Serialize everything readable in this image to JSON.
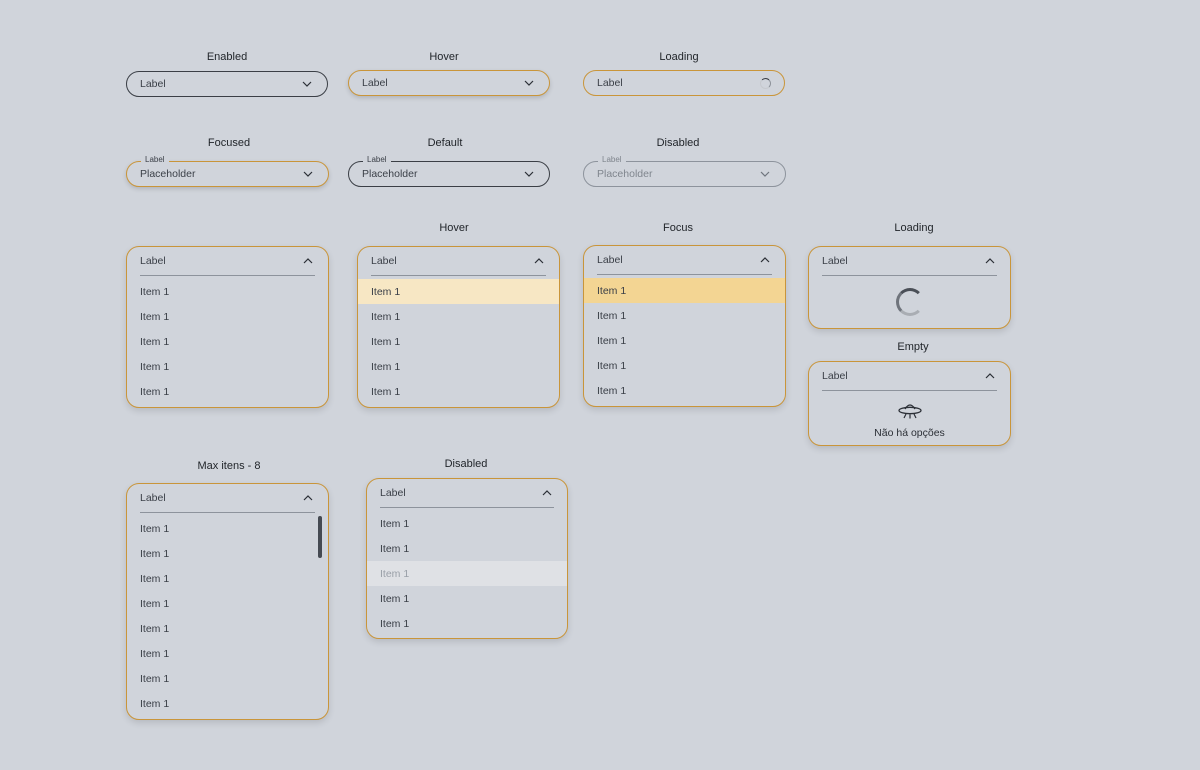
{
  "captions": {
    "enabled": "Enabled",
    "hover": "Hover",
    "loading": "Loading",
    "focused": "Focused",
    "default": "Default",
    "disabled": "Disabled",
    "list_hover": "Hover",
    "list_focus": "Focus",
    "list_loading": "Loading",
    "list_empty": "Empty",
    "max_items": "Max itens - 8",
    "list_disabled": "Disabled"
  },
  "selects": {
    "enabled": {
      "label": "Label"
    },
    "hover": {
      "label": "Label"
    },
    "loading": {
      "label": "Label"
    },
    "focused": {
      "float_label": "Label",
      "placeholder": "Placeholder"
    },
    "default": {
      "float_label": "Label",
      "placeholder": "Placeholder"
    },
    "disabled": {
      "float_label": "Label",
      "placeholder": "Placeholder"
    }
  },
  "lists": {
    "basic": {
      "label": "Label",
      "items": [
        "Item 1",
        "Item 1",
        "Item 1",
        "Item 1",
        "Item 1"
      ]
    },
    "hover": {
      "label": "Label",
      "items": [
        "Item 1",
        "Item 1",
        "Item 1",
        "Item 1",
        "Item 1"
      ]
    },
    "focus": {
      "label": "Label",
      "items": [
        "Item 1",
        "Item 1",
        "Item 1",
        "Item 1",
        "Item 1"
      ]
    },
    "loading": {
      "label": "Label"
    },
    "empty": {
      "label": "Label",
      "message": "Não há opções"
    },
    "max": {
      "label": "Label",
      "items": [
        "Item 1",
        "Item 1",
        "Item 1",
        "Item 1",
        "Item 1",
        "Item 1",
        "Item 1",
        "Item 1"
      ]
    },
    "disabled": {
      "label": "Label",
      "items": [
        "Item 1",
        "Item 1",
        "Item 1",
        "Item 1",
        "Item 1"
      ]
    }
  },
  "colors": {
    "background": "#d0d4db",
    "accent_border": "#c9953a",
    "hover_item": "#f7e7c4",
    "focus_item": "#f3d593",
    "disabled_item": "#dfe1e5"
  },
  "icons": {
    "chevron_down": "chevron-down-icon",
    "chevron_up": "chevron-up-icon",
    "spinner": "spinner-icon",
    "empty": "ufo-icon"
  }
}
